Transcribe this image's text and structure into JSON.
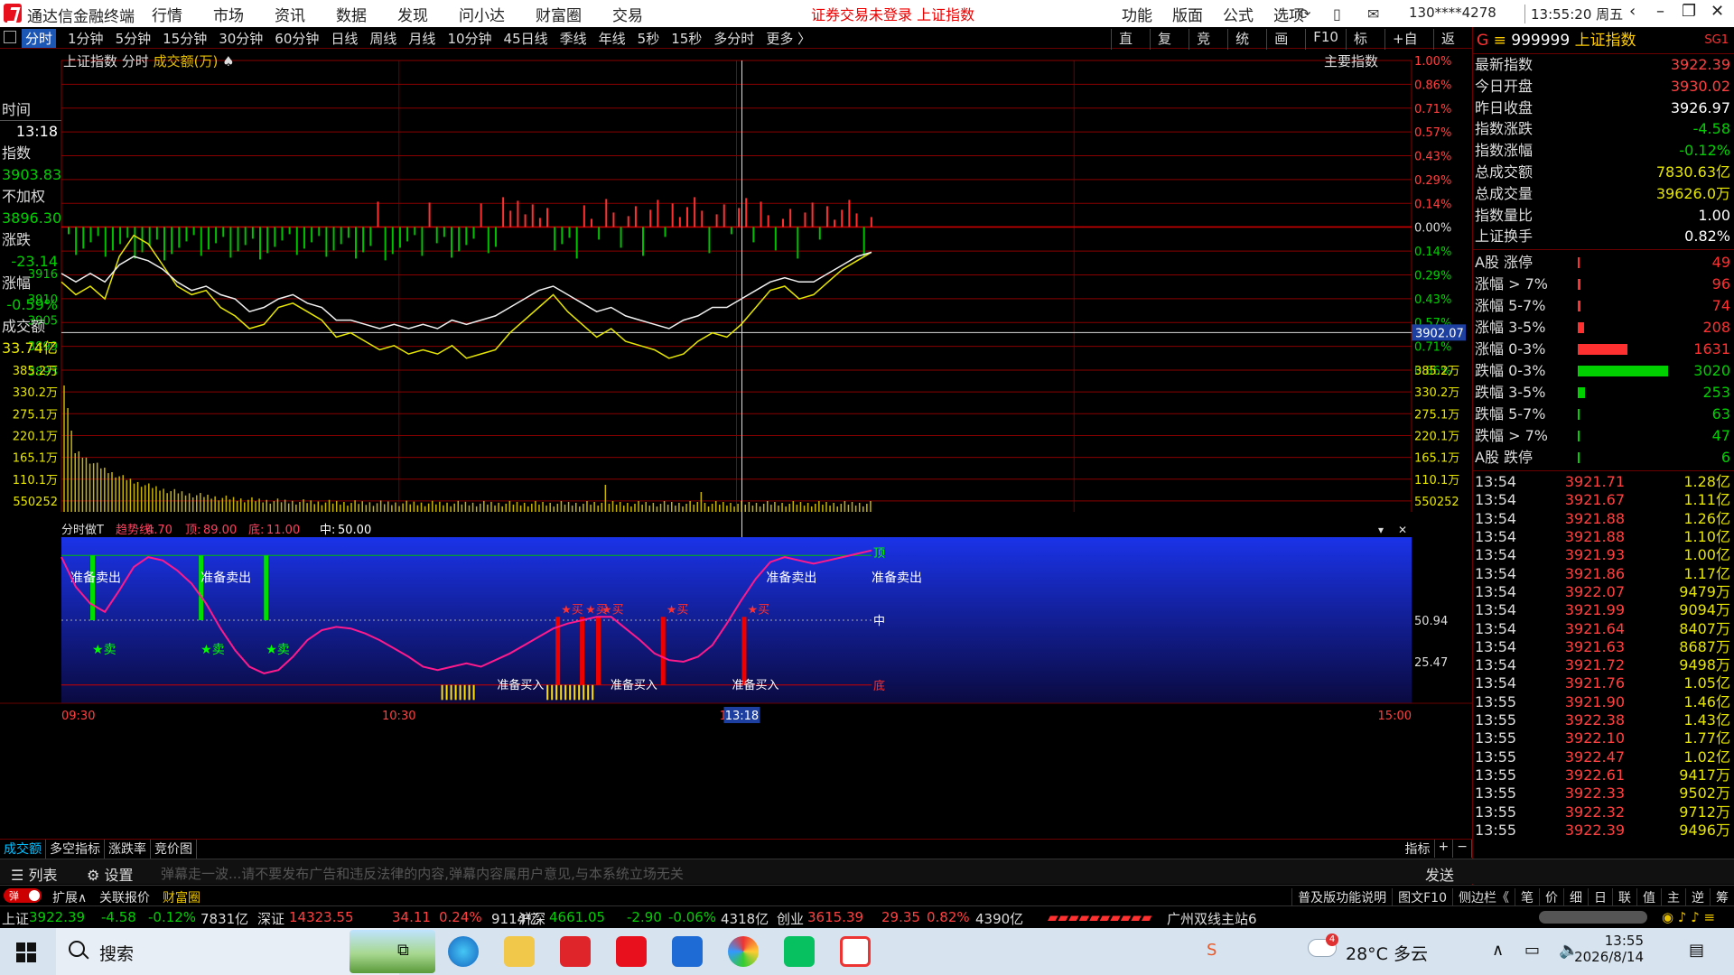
{
  "window": {
    "app_title": "通达信金融终端",
    "menu": [
      "行情",
      "市场",
      "资讯",
      "数据",
      "发现",
      "问小达",
      "财富圈",
      "交易"
    ],
    "warning": "证券交易未登录",
    "warning_index": "上证指数",
    "right_menu": [
      "功能",
      "版面",
      "公式",
      "选项"
    ],
    "user": "130****4278",
    "clock": "13:55:20 周五"
  },
  "periods": {
    "items": [
      "分时",
      "1分钟",
      "5分钟",
      "15分钟",
      "30分钟",
      "60分钟",
      "日线",
      "周线",
      "月线",
      "10分钟",
      "45日线",
      "季线",
      "年线",
      "5秒",
      "15秒",
      "多分时",
      "更多 〉"
    ],
    "active": "分时"
  },
  "tools": [
    "直播",
    "复盘",
    "竞价",
    "统计",
    "画线",
    "F10",
    "标记",
    "+自选",
    "返回"
  ],
  "left_panel": {
    "time_label": "时间",
    "time_value": "13:18",
    "index_label": "指数",
    "index_value": "3903.83",
    "unadj_label": "不加权",
    "unadj_value": "3896.30",
    "change_label": "涨跌",
    "change_value": "-23.14",
    "pct_label": "涨幅",
    "pct_value": "-0.59%",
    "amount_label": "成交额",
    "amount_value": "33.74亿"
  },
  "chart_header": {
    "name": "上证指数",
    "mode": "分时",
    "metric": "成交额(万)",
    "main_index": "主要指数"
  },
  "chart_data": [
    {
      "type": "line",
      "title": "上证指数 分时",
      "prev_close": 3926.97,
      "price_ticks_left": [
        "3916",
        "3910",
        "3905",
        "3899",
        "3893"
      ],
      "pct_ticks_right": [
        "1.00%",
        "0.86%",
        "0.71%",
        "0.57%",
        "0.43%",
        "0.29%",
        "0.14%",
        "0.00%",
        "0.14%",
        "0.29%",
        "0.43%",
        "0.57%",
        "0.71%",
        "0.86%"
      ],
      "cursor_price": "3902.07",
      "x_ticks": [
        "09:30",
        "10:30",
        "13:00",
        "13:18",
        "15:00"
      ],
      "series": [
        {
          "name": "指数",
          "color": "#e6e600",
          "values": [
            3914,
            3911,
            3913,
            3910,
            3920,
            3925,
            3923,
            3918,
            3913,
            3911,
            3912,
            3908,
            3906,
            3903,
            3904,
            3908,
            3909,
            3907,
            3905,
            3901,
            3902,
            3900,
            3898,
            3899,
            3897,
            3898,
            3897,
            3899,
            3896,
            3897,
            3898,
            3902,
            3905,
            3908,
            3911,
            3907,
            3904,
            3901,
            3903,
            3900,
            3899,
            3898,
            3896,
            3897,
            3900,
            3902,
            3901,
            3904,
            3908,
            3912,
            3913,
            3910,
            3911,
            3914,
            3917,
            3919,
            3921
          ]
        },
        {
          "name": "不加权",
          "color": "#f0f0f0",
          "values": [
            3916,
            3914,
            3916,
            3914,
            3918,
            3920,
            3919,
            3917,
            3914,
            3912,
            3913,
            3911,
            3910,
            3907,
            3908,
            3910,
            3911,
            3909,
            3908,
            3905,
            3905,
            3904,
            3903,
            3904,
            3903,
            3904,
            3903,
            3905,
            3904,
            3905,
            3906,
            3908,
            3910,
            3912,
            3913,
            3911,
            3909,
            3907,
            3908,
            3906,
            3905,
            3904,
            3903,
            3905,
            3906,
            3908,
            3908,
            3910,
            3912,
            3914,
            3915,
            3914,
            3914,
            3916,
            3918,
            3920,
            3921
          ]
        }
      ]
    },
    {
      "type": "bar",
      "title": "成交额(万)",
      "ticks": [
        "385.2万",
        "330.2万",
        "275.1万",
        "220.1万",
        "165.1万",
        "110.1万",
        "550252"
      ]
    },
    {
      "type": "line",
      "title": "分时做T",
      "params": {
        "trend_label": "趋势线:",
        "trend": "4.70",
        "top_label": "顶:",
        "top": "89.00",
        "bottom_label": "底:",
        "bottom": "11.00",
        "mid_label": "中:",
        "mid": "50.00"
      },
      "ticks": [
        "50.94",
        "25.47"
      ],
      "level_labels": {
        "top": "顶",
        "mid": "中",
        "bottom": "底"
      },
      "signals": {
        "sell": "准备卖出",
        "buy": "准备买入",
        "sell_arrow": "★卖",
        "buy_arrow": "★买"
      },
      "values": [
        88,
        70,
        60,
        55,
        68,
        82,
        88,
        86,
        80,
        72,
        60,
        45,
        32,
        22,
        18,
        20,
        28,
        38,
        44,
        46,
        45,
        42,
        38,
        33,
        28,
        22,
        20,
        22,
        24,
        22,
        26,
        30,
        35,
        40,
        45,
        48,
        50,
        52,
        52,
        45,
        38,
        30,
        26,
        25,
        28,
        35,
        48,
        62,
        75,
        85,
        88,
        86,
        84,
        86,
        88,
        90,
        92
      ]
    }
  ],
  "right_panel": {
    "code": "999999",
    "name": "上证指数",
    "tag": "SG1",
    "stats": [
      {
        "k": "最新指数",
        "v": "3922.39",
        "c": "r"
      },
      {
        "k": "今日开盘",
        "v": "3930.02",
        "c": "r"
      },
      {
        "k": "昨日收盘",
        "v": "3926.97",
        "c": "w"
      },
      {
        "k": "指数涨跌",
        "v": "-4.58",
        "c": "g"
      },
      {
        "k": "指数涨幅",
        "v": "-0.12%",
        "c": "g"
      },
      {
        "k": "总成交额",
        "v": "7830.63亿",
        "c": "y"
      },
      {
        "k": "总成交量",
        "v": "39626.0万",
        "c": "y"
      },
      {
        "k": "指数量比",
        "v": "1.00",
        "c": "w"
      },
      {
        "k": "上证换手",
        "v": "0.82%",
        "c": "w"
      }
    ],
    "dist": [
      {
        "k": "A股 涨停",
        "v": "49",
        "c": "#ff3030",
        "w": 0.02
      },
      {
        "k": "涨幅 > 7%",
        "v": "96",
        "c": "#ff3030",
        "w": 0.03
      },
      {
        "k": "涨幅 5-7%",
        "v": "74",
        "c": "#ff3030",
        "w": 0.025
      },
      {
        "k": "涨幅 3-5%",
        "v": "208",
        "c": "#ff3030",
        "w": 0.07
      },
      {
        "k": "涨幅 0-3%",
        "v": "1631",
        "c": "#ff3030",
        "w": 0.55
      },
      {
        "k": "跌幅 0-3%",
        "v": "3020",
        "c": "#00d000",
        "w": 1.0
      },
      {
        "k": "跌幅 3-5%",
        "v": "253",
        "c": "#00d000",
        "w": 0.08
      },
      {
        "k": "跌幅 5-7%",
        "v": "63",
        "c": "#00d000",
        "w": 0.02
      },
      {
        "k": "跌幅 > 7%",
        "v": "47",
        "c": "#00d000",
        "w": 0.015
      },
      {
        "k": "A股 跌停",
        "v": "6",
        "c": "#00d000",
        "w": 0.01
      }
    ],
    "ticks": [
      {
        "t": "13:54",
        "p": "3921.71",
        "v": "1.28亿"
      },
      {
        "t": "13:54",
        "p": "3921.67",
        "v": "1.11亿"
      },
      {
        "t": "13:54",
        "p": "3921.88",
        "v": "1.26亿"
      },
      {
        "t": "13:54",
        "p": "3921.88",
        "v": "1.10亿"
      },
      {
        "t": "13:54",
        "p": "3921.93",
        "v": "1.00亿"
      },
      {
        "t": "13:54",
        "p": "3921.86",
        "v": "1.17亿"
      },
      {
        "t": "13:54",
        "p": "3922.07",
        "v": "9479万"
      },
      {
        "t": "13:54",
        "p": "3921.99",
        "v": "9094万"
      },
      {
        "t": "13:54",
        "p": "3921.64",
        "v": "8407万"
      },
      {
        "t": "13:54",
        "p": "3921.63",
        "v": "8687万"
      },
      {
        "t": "13:54",
        "p": "3921.72",
        "v": "9498万"
      },
      {
        "t": "13:54",
        "p": "3921.76",
        "v": "1.05亿"
      },
      {
        "t": "13:55",
        "p": "3921.90",
        "v": "1.46亿"
      },
      {
        "t": "13:55",
        "p": "3922.38",
        "v": "1.43亿"
      },
      {
        "t": "13:55",
        "p": "3922.10",
        "v": "1.77亿"
      },
      {
        "t": "13:55",
        "p": "3922.47",
        "v": "1.02亿"
      },
      {
        "t": "13:55",
        "p": "3922.61",
        "v": "9417万"
      },
      {
        "t": "13:55",
        "p": "3922.33",
        "v": "9502万"
      },
      {
        "t": "13:55",
        "p": "3922.32",
        "v": "9712万"
      },
      {
        "t": "13:55",
        "p": "3922.39",
        "v": "9496万"
      }
    ]
  },
  "subtabs": [
    "成交额",
    "多空指标",
    "涨跌率",
    "竞价图"
  ],
  "subtabs_right": [
    "指标",
    "+",
    "−"
  ],
  "input": {
    "list": "列表",
    "settings": "设置",
    "placeholder": "弹幕走一波...请不要发布广告和违反法律的内容,弹幕内容属用户意见,与本系统立场无关",
    "send": "发送"
  },
  "footer1": {
    "toggle": "弹",
    "expand": "扩展∧",
    "related": "关联报价",
    "wealth": "财富圈",
    "right": [
      "普及版功能说明",
      "图文F10",
      "侧边栏《",
      "笔",
      "价",
      "细",
      "日",
      "联",
      "值",
      "主",
      "逆",
      "筹"
    ]
  },
  "footer2": {
    "sh_label": "上证",
    "sh_price": "3922.39",
    "sh_chg": "-4.58",
    "sh_pct": "-0.12%",
    "sh_amt": "7831亿",
    "sz_label": "深证",
    "sz_price": "14323.55",
    "sz_chg": "34.11",
    "sz_pct": "0.24%",
    "sz_amt": "9114亿",
    "hs_label": "沪深",
    "hs_price": "4661.05",
    "hs_chg": "-2.90",
    "hs_pct": "-0.06%",
    "hs_amt": "4318亿",
    "cy_label": "创业",
    "cy_price": "3615.39",
    "cy_chg": "29.35",
    "cy_pct": "0.82%",
    "cy_amt": "4390亿",
    "server": "广州双线主站6"
  },
  "taskbar": {
    "search": "搜索",
    "weather_temp": "28°C",
    "weather_text": "多云",
    "weather_badge": "4",
    "time": "13:55",
    "date": "2026/8/14"
  }
}
